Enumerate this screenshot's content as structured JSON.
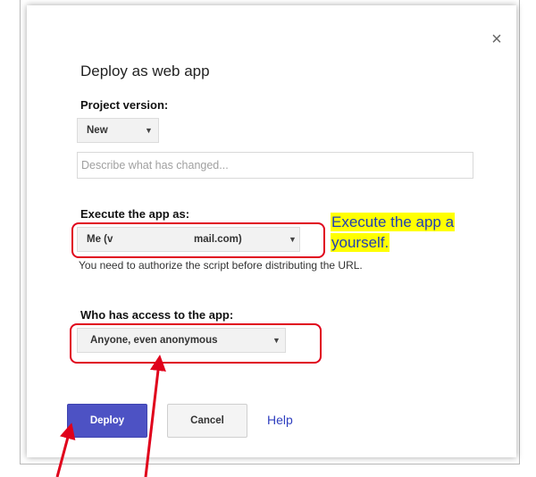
{
  "dialog": {
    "title": "Deploy as web app",
    "close_glyph": "×",
    "project_version": {
      "label": "Project version:",
      "selected": "New",
      "description_placeholder": "Describe what has changed..."
    },
    "execute_as": {
      "label": "Execute the app as:",
      "selected_prefix": "Me (v",
      "selected_suffix": "mail.com)",
      "helper": "You need to authorize the script before distributing the URL."
    },
    "access": {
      "label": "Who has access to the app:",
      "selected": "Anyone, even anonymous"
    },
    "buttons": {
      "deploy": "Deploy",
      "cancel": "Cancel",
      "help": "Help"
    }
  },
  "annotation": {
    "callout_line1": "Execute the app a",
    "callout_line2": "yourself.",
    "highlight_color": "#e0001b",
    "callout_bg": "#ffff00"
  },
  "icons": {
    "caret": "▼"
  }
}
